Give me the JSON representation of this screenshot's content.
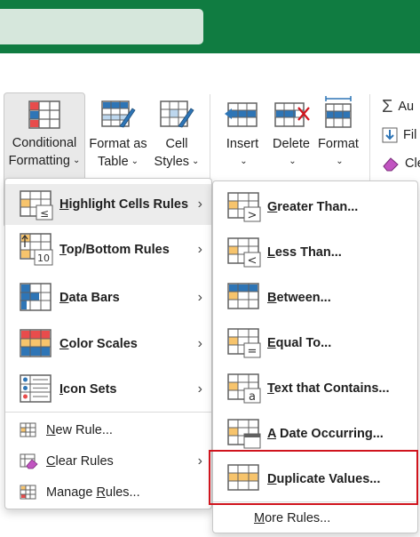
{
  "ribbon": {
    "conditional_formatting": {
      "line1": "Conditional",
      "line2": "Formatting"
    },
    "format_as_table": {
      "line1": "Format as",
      "line2": "Table"
    },
    "cell_styles": {
      "line1": "Cell",
      "line2": "Styles"
    },
    "insert": "Insert",
    "delete": "Delete",
    "format": "Format",
    "autosum": "Au",
    "fill": "Fil",
    "clear": "Cle",
    "chevron": "⌄"
  },
  "menu_main": {
    "items": [
      {
        "key": "H",
        "rest": "ighlight Cells Rules",
        "submenu": true
      },
      {
        "key": "T",
        "rest": "op/Bottom Rules",
        "submenu": true
      },
      {
        "key": "D",
        "rest": "ata Bars",
        "submenu": true
      },
      {
        "key": "C",
        "rest": "olor Scales",
        "submenu": true
      },
      {
        "key": "I",
        "rest": "con Sets",
        "submenu": true
      }
    ],
    "actions": [
      {
        "key": "N",
        "rest": "ew Rule...",
        "submenu": false
      },
      {
        "key": "C",
        "rest": "lear Rules",
        "submenu": true
      },
      {
        "pre": "Manage ",
        "key": "R",
        "rest": "ules...",
        "submenu": false
      }
    ]
  },
  "menu_highlight": {
    "items": [
      {
        "key": "G",
        "rest": "reater Than..."
      },
      {
        "key": "L",
        "rest": "ess Than..."
      },
      {
        "key": "B",
        "rest": "etween..."
      },
      {
        "key": "E",
        "rest": "qual To..."
      },
      {
        "key": "T",
        "rest": "ext that Contains..."
      },
      {
        "key": "A",
        "rest": " Date Occurring..."
      },
      {
        "key": "D",
        "rest": "uplicate Values..."
      }
    ],
    "more": {
      "key": "M",
      "rest": "ore Rules..."
    },
    "icon_glyphs": [
      ">",
      "<",
      "",
      "=",
      "a",
      "",
      ""
    ]
  },
  "colors": {
    "excel_green": "#107c41",
    "highlight_red": "#d0141d",
    "accent_blue": "#2e75b6",
    "cell_orange": "#f7c46c"
  }
}
